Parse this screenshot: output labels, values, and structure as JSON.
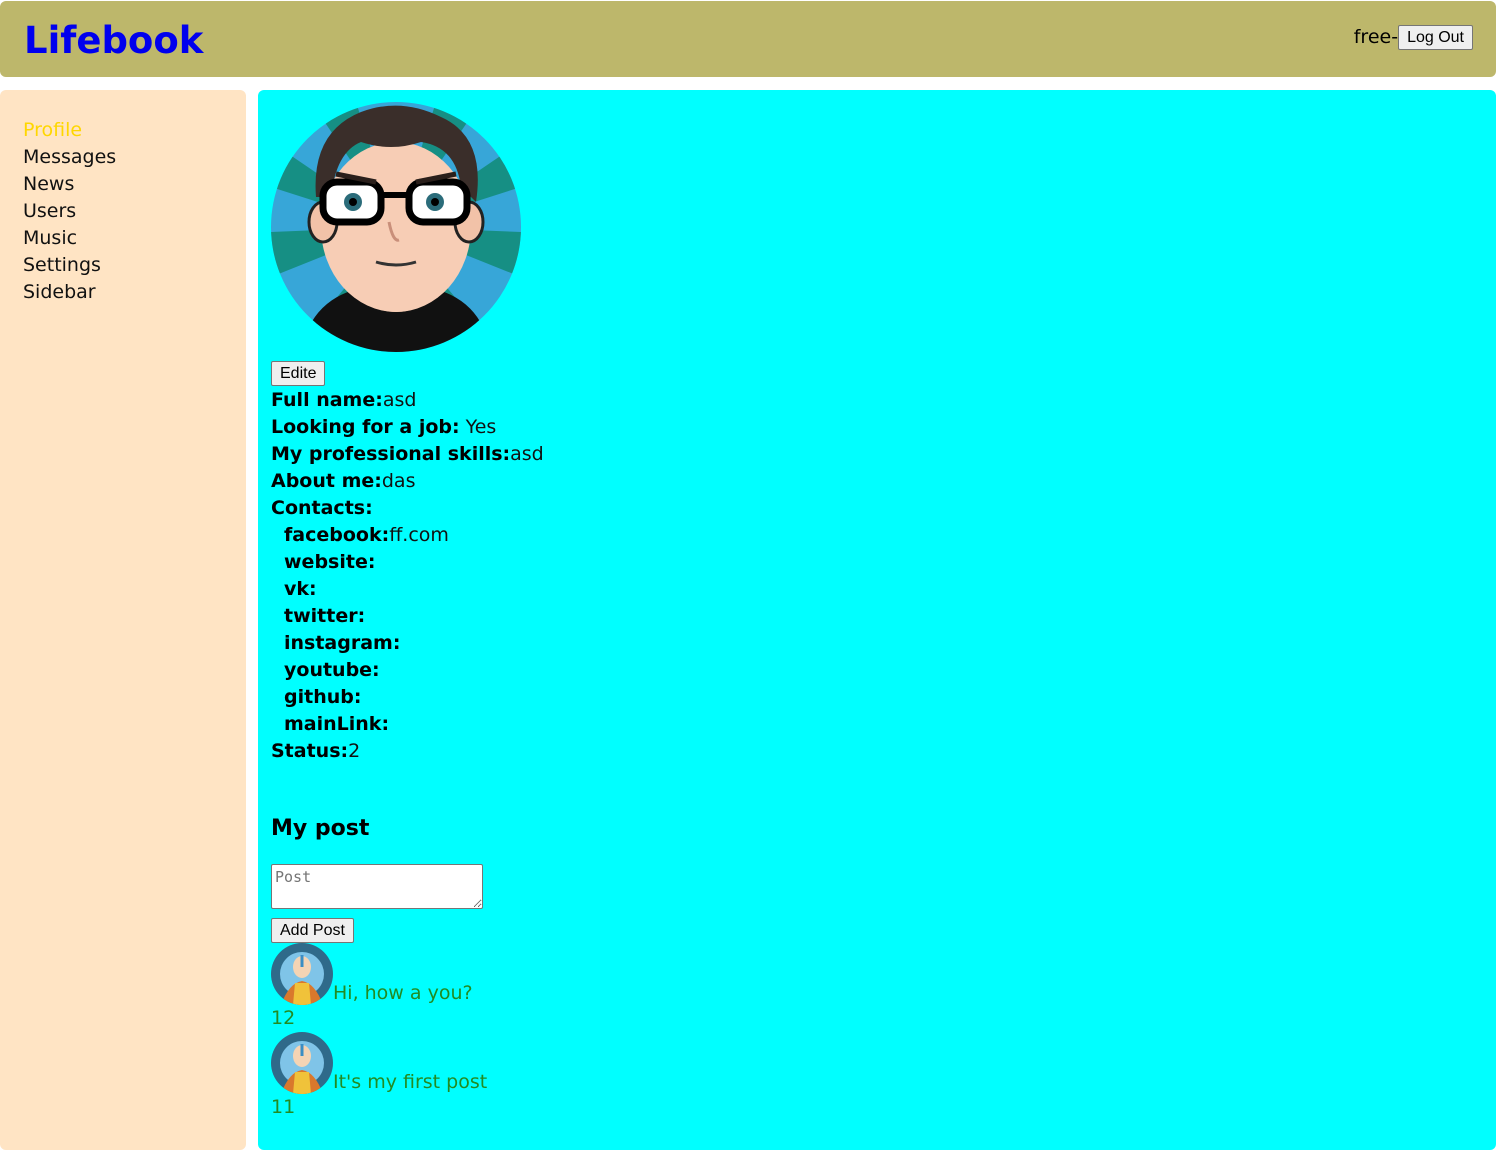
{
  "header": {
    "logo": "Lifebook",
    "login_name": "free-",
    "logout_label": "Log Out"
  },
  "sidebar": {
    "items": [
      {
        "label": "Profile",
        "active": true
      },
      {
        "label": "Messages"
      },
      {
        "label": "News"
      },
      {
        "label": "Users"
      },
      {
        "label": "Music"
      },
      {
        "label": "Settings"
      },
      {
        "label": "Sidebar"
      }
    ]
  },
  "profile": {
    "edit_label": "Edite",
    "full_name_label": "Full name:",
    "full_name": "asd",
    "job_label": "Looking for a job:",
    "job_value": " Yes",
    "skills_label": "My professional skills:",
    "skills": "asd",
    "about_label": "About me:",
    "about": "das",
    "contacts_label": "Contacts:",
    "contacts": [
      {
        "label": "facebook:",
        "value": "ff.com"
      },
      {
        "label": "website:",
        "value": ""
      },
      {
        "label": "vk:",
        "value": ""
      },
      {
        "label": "twitter:",
        "value": ""
      },
      {
        "label": "instagram:",
        "value": ""
      },
      {
        "label": "youtube:",
        "value": ""
      },
      {
        "label": "github:",
        "value": ""
      },
      {
        "label": "mainLink:",
        "value": ""
      }
    ],
    "status_label": "Status:",
    "status": "2"
  },
  "posts": {
    "title": "My post",
    "placeholder": "Post",
    "add_label": "Add Post",
    "items": [
      {
        "text": "Hi, how a you?",
        "likes": "12"
      },
      {
        "text": "It's my first post",
        "likes": "11"
      }
    ]
  },
  "colors": {
    "header_bg": "#bdb76b",
    "sidebar_bg": "#ffe4c4",
    "content_bg": "#00ffff",
    "logo": "#0000ee",
    "active_nav": "#ffd700",
    "post_text": "#228b22"
  }
}
